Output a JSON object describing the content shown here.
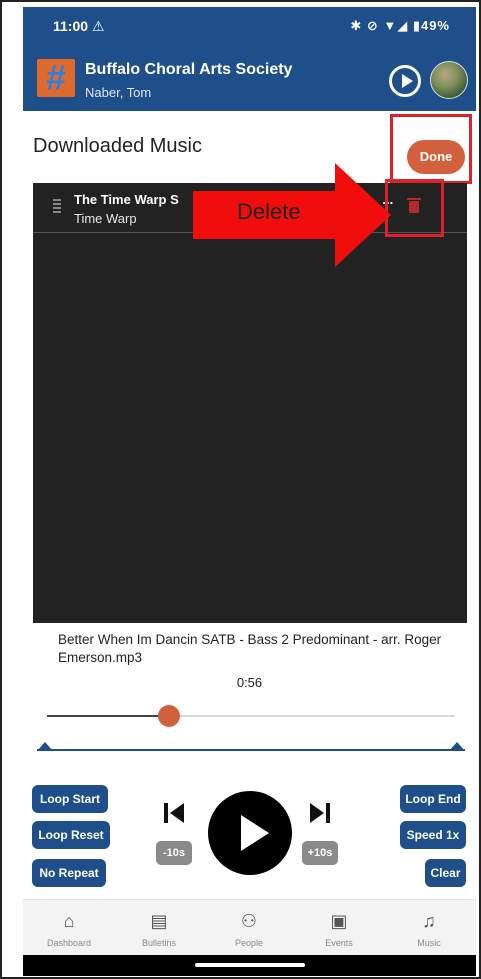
{
  "status_bar": {
    "time": "11:00",
    "time_icon": "android-auto-icon",
    "right_text": "✱ ⊘ ▼◢ ▮49%",
    "battery": "49%"
  },
  "app_bar": {
    "org_name": "Buffalo Choral Arts Society",
    "user_name": "Naber, Tom",
    "logo_icon": "hash-logo-icon",
    "play_icon": "play-circle-icon",
    "avatar_icon": "user-avatar"
  },
  "header": {
    "title": "Downloaded Music",
    "done_label": "Done"
  },
  "playlist": {
    "items": [
      {
        "title": "The Time Warp S",
        "title_suffix": "...",
        "subtitle": "Time Warp"
      }
    ]
  },
  "annotation": {
    "label": "Delete",
    "color": "#f20d0d"
  },
  "now_playing": {
    "file_name": "Better When Im Dancin SATB - Bass 2 Predominant - arr. Roger Emerson.mp3",
    "elapsed": "0:56",
    "position_fraction": 0.3
  },
  "loop_range": {
    "start_fraction": 0.0,
    "end_fraction": 1.0
  },
  "controls": {
    "loop_start": "Loop Start",
    "loop_reset": "Loop Reset",
    "no_repeat": "No Repeat",
    "loop_end": "Loop End",
    "speed": "Speed 1x",
    "clear": "Clear",
    "back10": "-10s",
    "fwd10": "+10s"
  },
  "bottom_nav": {
    "items": [
      {
        "label": "Dashboard",
        "icon": "home-icon"
      },
      {
        "label": "Bulletins",
        "icon": "bulletin-icon"
      },
      {
        "label": "People",
        "icon": "people-icon"
      },
      {
        "label": "Events",
        "icon": "calendar-icon"
      },
      {
        "label": "Music",
        "icon": "music-note-icon"
      }
    ]
  },
  "colors": {
    "primary": "#1f4f8b",
    "accent": "#d2603c",
    "highlight": "#e0202a"
  }
}
